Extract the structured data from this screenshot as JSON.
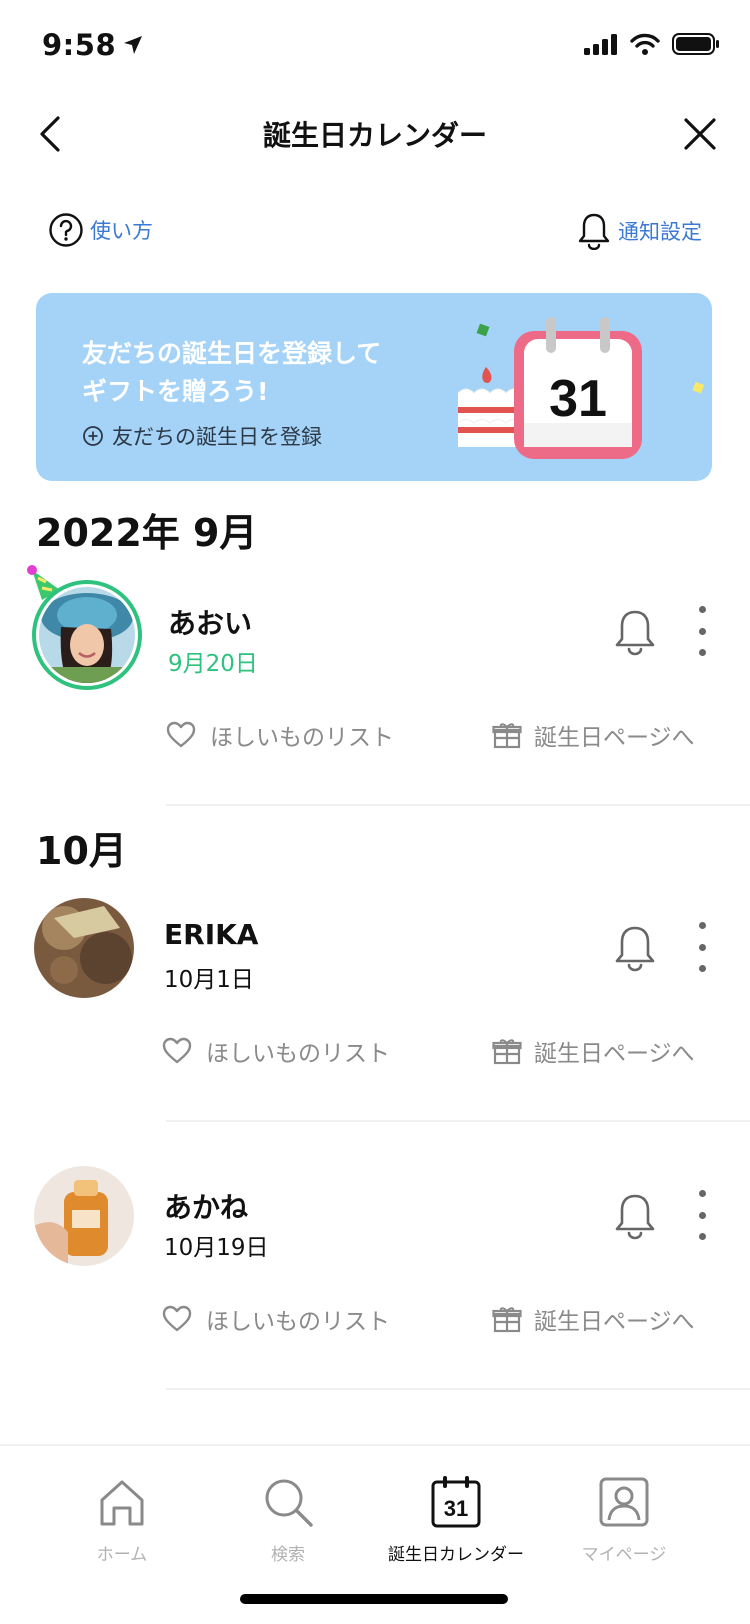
{
  "status_bar": {
    "time": "9:58"
  },
  "nav": {
    "title": "誕生日カレンダー"
  },
  "help": {
    "how_to_use": "使い方",
    "notification_settings": "通知設定"
  },
  "banner": {
    "headline_line1": "友だちの誕生日を登録して",
    "headline_line2": "ギフトを贈ろう!",
    "register_link": "友だちの誕生日を登録",
    "calendar_number": "31"
  },
  "months": [
    {
      "label": "2022年 9月",
      "friends": [
        {
          "name": "あおい",
          "date": "9月20日",
          "is_today": true
        }
      ]
    },
    {
      "label": "10月",
      "friends": [
        {
          "name": "ERIKA",
          "date": "10月1日",
          "is_today": false
        },
        {
          "name": "あかね",
          "date": "10月19日",
          "is_today": false
        }
      ]
    }
  ],
  "actions": {
    "wishlist": "ほしいものリスト",
    "birthday_page": "誕生日ページへ"
  },
  "tab_bar": {
    "tabs": [
      {
        "label": "ホーム",
        "icon": "home-icon",
        "active": false
      },
      {
        "label": "検索",
        "icon": "search-icon",
        "active": false
      },
      {
        "label": "誕生日カレンダー",
        "icon": "calendar-icon",
        "active": true,
        "icon_number": "31"
      },
      {
        "label": "マイページ",
        "icon": "profile-icon",
        "active": false
      }
    ]
  },
  "colors": {
    "accent_link": "#3b79d4",
    "banner_bg": "#a4d3f7",
    "today_green": "#2ec27e",
    "muted": "#8a8a8a"
  }
}
